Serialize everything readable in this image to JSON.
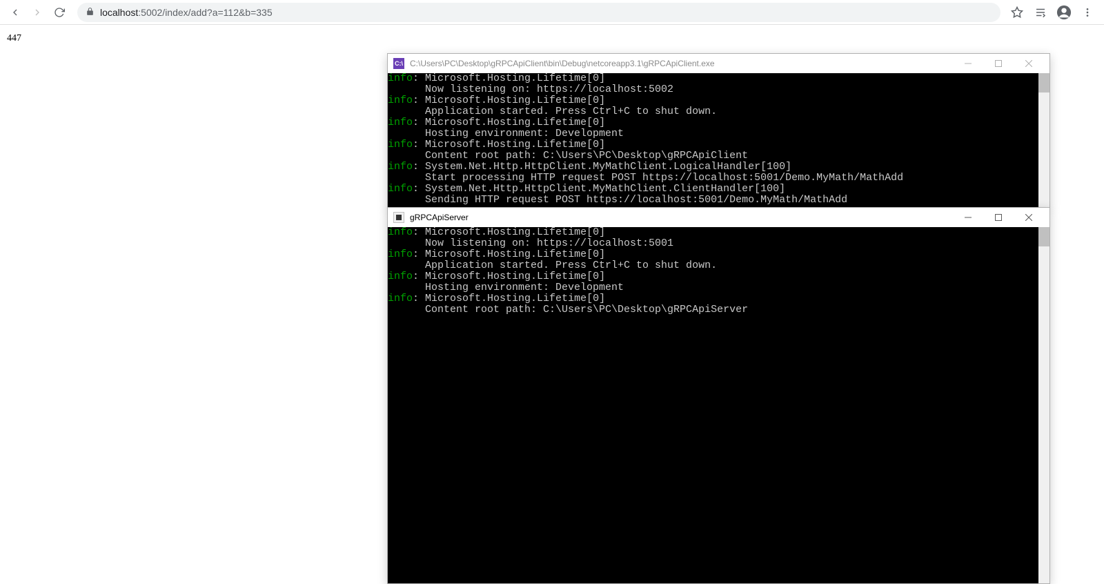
{
  "browser": {
    "url_host": "localhost",
    "url_rest": ":5002/index/add?a=112&b=335"
  },
  "page": {
    "result_text": "447"
  },
  "client_window": {
    "title": "C:\\Users\\PC\\Desktop\\gRPCApiClient\\bin\\Debug\\netcoreapp3.1\\gRPCApiClient.exe",
    "icon_label": "C:\\",
    "lines": [
      {
        "level": "info",
        "head": "Microsoft.Hosting.Lifetime[0]",
        "body": "Now listening on: https://localhost:5002"
      },
      {
        "level": "info",
        "head": "Microsoft.Hosting.Lifetime[0]",
        "body": "Application started. Press Ctrl+C to shut down."
      },
      {
        "level": "info",
        "head": "Microsoft.Hosting.Lifetime[0]",
        "body": "Hosting environment: Development"
      },
      {
        "level": "info",
        "head": "Microsoft.Hosting.Lifetime[0]",
        "body": "Content root path: C:\\Users\\PC\\Desktop\\gRPCApiClient"
      },
      {
        "level": "info",
        "head": "System.Net.Http.HttpClient.MyMathClient.LogicalHandler[100]",
        "body": "Start processing HTTP request POST https://localhost:5001/Demo.MyMath/MathAdd"
      },
      {
        "level": "info",
        "head": "System.Net.Http.HttpClient.MyMathClient.ClientHandler[100]",
        "body": "Sending HTTP request POST https://localhost:5001/Demo.MyMath/MathAdd"
      }
    ]
  },
  "server_window": {
    "title": "gRPCApiServer",
    "lines": [
      {
        "level": "info",
        "head": "Microsoft.Hosting.Lifetime[0]",
        "body": "Now listening on: https://localhost:5001"
      },
      {
        "level": "info",
        "head": "Microsoft.Hosting.Lifetime[0]",
        "body": "Application started. Press Ctrl+C to shut down."
      },
      {
        "level": "info",
        "head": "Microsoft.Hosting.Lifetime[0]",
        "body": "Hosting environment: Development"
      },
      {
        "level": "info",
        "head": "Microsoft.Hosting.Lifetime[0]",
        "body": "Content root path: C:\\Users\\PC\\Desktop\\gRPCApiServer"
      }
    ]
  }
}
